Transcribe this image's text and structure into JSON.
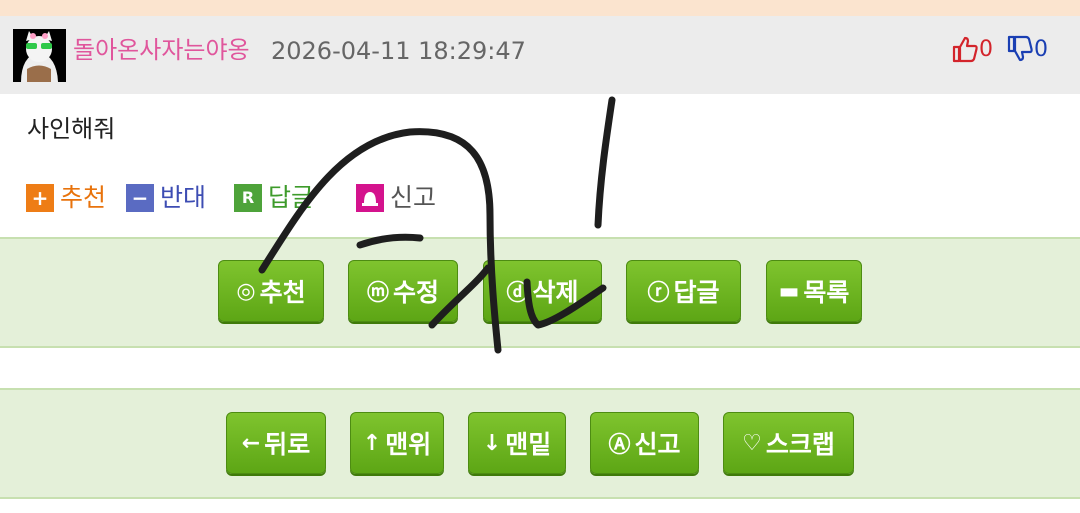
{
  "header": {
    "username": "돌아온사자는야옹",
    "datetime": "2026-04-11 18:29:47",
    "upvote_count": "0",
    "downvote_count": "0"
  },
  "post": {
    "content": "사인해줘"
  },
  "actions": {
    "recommend": "추천",
    "oppose": "반대",
    "reply": "답글",
    "report": "신고",
    "recommend_icon": "+",
    "oppose_icon": "−",
    "reply_icon": "R"
  },
  "buttons_row1": {
    "recommend": "추천",
    "edit": "수정",
    "delete": "삭제",
    "reply": "답글",
    "list": "목록"
  },
  "buttons_row2": {
    "back": "뒤로",
    "top": "맨위",
    "bottom": "맨밑",
    "report": "신고",
    "scrap": "스크랩"
  },
  "icons": {
    "recommend": "◎",
    "edit": "ⓜ",
    "delete": "ⓓ",
    "reply": "ⓡ",
    "list": "▬",
    "back": "←",
    "top": "↑",
    "bottom": "↓",
    "report": "Ⓐ",
    "scrap": "♡"
  },
  "colors": {
    "username": "#e0569c",
    "upvote": "#d3242b",
    "downvote": "#1a3fb3",
    "button_green": "#6bb41f",
    "band_green": "#e4f0d9"
  }
}
